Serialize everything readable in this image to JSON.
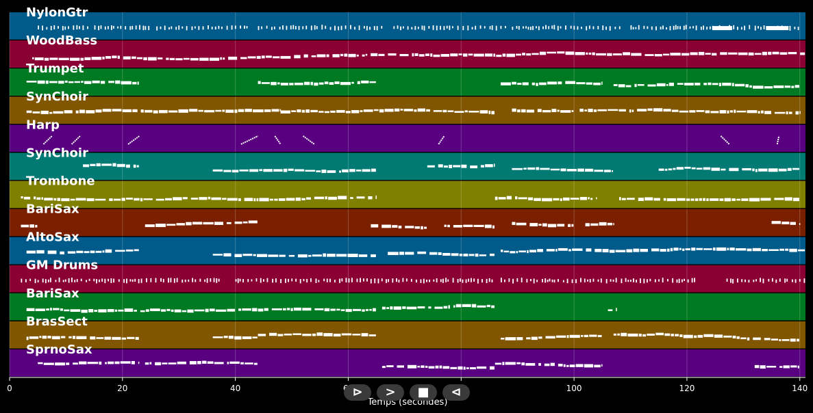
{
  "chart_data": {
    "type": "piano-roll",
    "xlabel": "Temps (secondes)",
    "xlim": [
      0,
      141
    ],
    "x_ticks": [
      0,
      20,
      40,
      60,
      80,
      100,
      120,
      140
    ],
    "grid": true,
    "tracks": [
      {
        "name": "NylonGtr",
        "color": "#005a8a",
        "style": "ticks",
        "segments": [
          [
            5,
            14
          ],
          [
            15,
            25
          ],
          [
            26,
            42
          ],
          [
            44,
            66
          ],
          [
            68,
            88
          ],
          [
            89,
            108
          ],
          [
            110,
            124
          ],
          [
            124,
            131
          ],
          [
            132,
            140
          ]
        ],
        "dense": [
          [
            124.5,
            128
          ],
          [
            134,
            138
          ]
        ]
      },
      {
        "name": "WoodBass",
        "color": "#8a0033",
        "style": "line",
        "segments": [
          [
            4,
            141
          ]
        ]
      },
      {
        "name": "Trumpet",
        "color": "#007a22",
        "style": "line",
        "segments": [
          [
            3,
            23
          ],
          [
            44,
            65
          ],
          [
            87,
            105
          ],
          [
            107,
            140
          ]
        ]
      },
      {
        "name": "SynChoir",
        "color": "#805600",
        "style": "line",
        "segments": [
          [
            3,
            48
          ],
          [
            48,
            86
          ],
          [
            89,
            100
          ],
          [
            101,
            140
          ]
        ]
      },
      {
        "name": "Harp",
        "color": "#580080",
        "style": "sparse",
        "segments": [
          [
            6,
            7.5
          ],
          [
            11,
            12.5
          ],
          [
            21,
            23
          ],
          [
            41,
            44
          ],
          [
            47,
            48
          ],
          [
            52,
            54
          ],
          [
            76,
            77
          ],
          [
            126,
            127.5
          ],
          [
            136,
            136.3
          ]
        ]
      },
      {
        "name": "SynChoir",
        "color": "#007a72",
        "style": "line",
        "segments": [
          [
            13,
            23
          ],
          [
            36,
            65
          ],
          [
            74,
            86
          ],
          [
            89,
            107
          ],
          [
            115,
            140
          ]
        ]
      },
      {
        "name": "Trombone",
        "color": "#7f7f00",
        "style": "line",
        "segments": [
          [
            2,
            65
          ],
          [
            86,
            104
          ],
          [
            108,
            140
          ]
        ]
      },
      {
        "name": "BariSax",
        "color": "#7a2000",
        "style": "line",
        "segments": [
          [
            2,
            5
          ],
          [
            24,
            44
          ],
          [
            64,
            74
          ],
          [
            77,
            86
          ],
          [
            89,
            100
          ],
          [
            102,
            107
          ],
          [
            135,
            140
          ]
        ]
      },
      {
        "name": "AltoSax",
        "color": "#005a8a",
        "style": "line",
        "segments": [
          [
            3,
            23
          ],
          [
            36,
            65
          ],
          [
            67,
            86
          ],
          [
            87,
            141
          ]
        ]
      },
      {
        "name": "GM Drums",
        "color": "#8a0033",
        "style": "ticks",
        "segments": [
          [
            2,
            37
          ],
          [
            40,
            86
          ],
          [
            87,
            122
          ],
          [
            127,
            141
          ]
        ]
      },
      {
        "name": "BariSax",
        "color": "#007a22",
        "style": "line",
        "segments": [
          [
            3,
            65
          ],
          [
            66,
            86
          ],
          [
            106,
            107.5
          ]
        ]
      },
      {
        "name": "BrasSect",
        "color": "#805600",
        "style": "line",
        "segments": [
          [
            3,
            23
          ],
          [
            36,
            44
          ],
          [
            44,
            65
          ],
          [
            87,
            105
          ],
          [
            107,
            140
          ]
        ]
      },
      {
        "name": "SprnoSax",
        "color": "#580080",
        "style": "line",
        "segments": [
          [
            5,
            23
          ],
          [
            24,
            44
          ],
          [
            66,
            86
          ],
          [
            86,
            105
          ],
          [
            132,
            140
          ]
        ]
      }
    ]
  },
  "controls": {
    "play_label": "⊳",
    "forward_label": ">",
    "stop_label": "■",
    "rewind_label": "⊲"
  }
}
